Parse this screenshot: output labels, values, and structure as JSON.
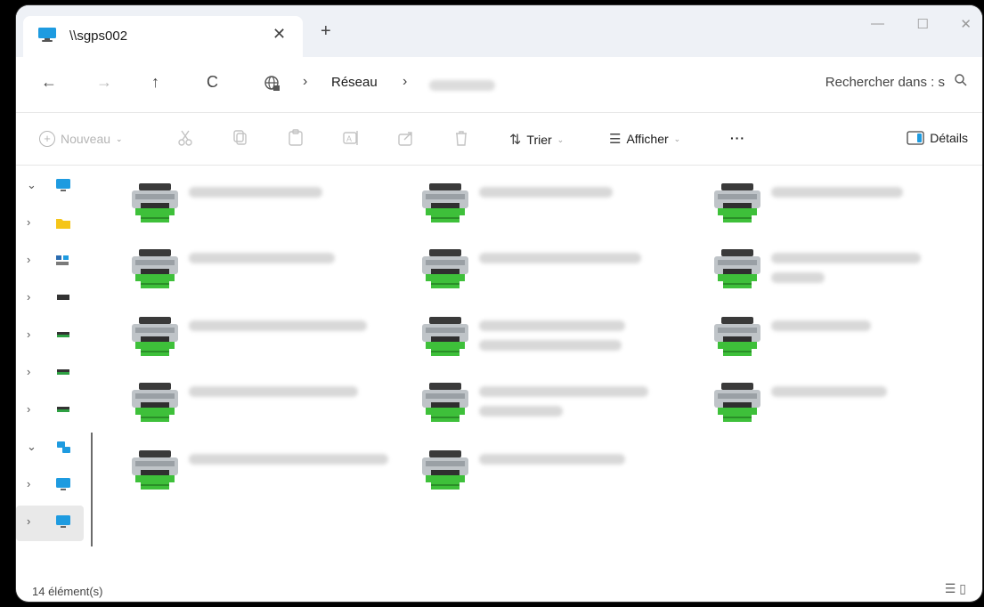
{
  "tab": {
    "title": "\\\\sgps002",
    "close": "✕"
  },
  "newtab": "+",
  "window_controls": {
    "minimize": "—",
    "maximize": "☐",
    "close": "✕"
  },
  "nav": {
    "back": "←",
    "forward": "→",
    "up": "↑",
    "refresh": "C",
    "sep": "›"
  },
  "breadcrumb": {
    "network": "Réseau"
  },
  "search": {
    "placeholder": "Rechercher dans : s"
  },
  "commands": {
    "new": "Nouveau",
    "sort": "Trier",
    "view": "Afficher",
    "more": "···",
    "details": "Détails",
    "caret": "⌄"
  },
  "sidebar": {
    "items": [
      {
        "chev": "⌄",
        "icon": "desktop-icon"
      },
      {
        "chev": "›",
        "icon": "folder-icon"
      },
      {
        "chev": "›",
        "icon": "gallery-icon"
      },
      {
        "chev": "›",
        "icon": "drive-icon"
      },
      {
        "chev": "›",
        "icon": "drive-icon"
      },
      {
        "chev": "›",
        "icon": "drive-icon"
      },
      {
        "chev": "›",
        "icon": "drive-icon"
      },
      {
        "chev": "⌄",
        "icon": "network-icon"
      },
      {
        "chev": "›",
        "icon": "computer-icon"
      },
      {
        "chev": "›",
        "icon": "computer-icon"
      }
    ]
  },
  "printers": [
    {
      "icon": "printer-icon",
      "lines": 1
    },
    {
      "icon": "printer-icon",
      "lines": 1
    },
    {
      "icon": "printer-icon",
      "lines": 1
    },
    {
      "icon": "printer-icon",
      "lines": 1
    },
    {
      "icon": "printer-icon",
      "lines": 1
    },
    {
      "icon": "printer-icon",
      "lines": 2
    },
    {
      "icon": "printer-icon",
      "lines": 1
    },
    {
      "icon": "printer-icon",
      "lines": 2
    },
    {
      "icon": "printer-icon",
      "lines": 1
    },
    {
      "icon": "printer-icon",
      "lines": 1
    },
    {
      "icon": "printer-icon",
      "lines": 2
    },
    {
      "icon": "printer-icon",
      "lines": 1
    },
    {
      "icon": "printer-icon",
      "lines": 1
    },
    {
      "icon": "printer-icon",
      "lines": 1
    }
  ],
  "status": {
    "count": "14 élément(s)"
  },
  "colors": {
    "accent": "#0f6cbd",
    "printer_green": "#3ec03a"
  }
}
